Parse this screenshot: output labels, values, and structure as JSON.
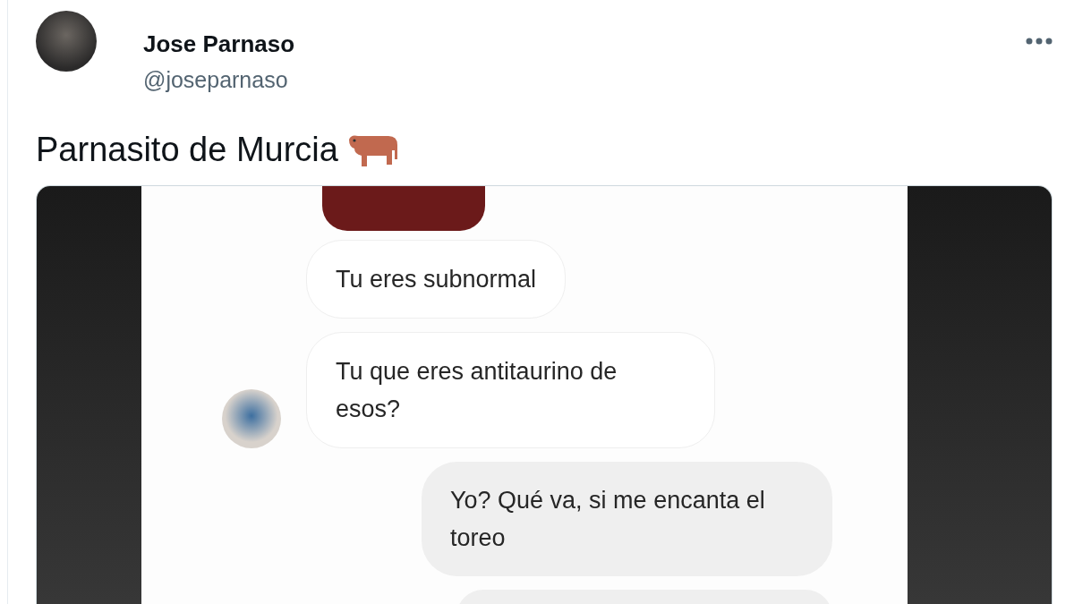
{
  "author": {
    "name": "Jose Parnaso",
    "handle": "@joseparnaso"
  },
  "tweet_text": "Parnasito de Murcia",
  "chat": {
    "messages": [
      {
        "kind": "received",
        "text": "Tu eres subnormal",
        "avatar": false
      },
      {
        "kind": "received",
        "text": "Tu que eres antitaurino de esos?",
        "avatar": true
      },
      {
        "kind": "sent",
        "text": "Yo? Qué va, si me encanta el toreo",
        "avatar": false
      }
    ]
  }
}
